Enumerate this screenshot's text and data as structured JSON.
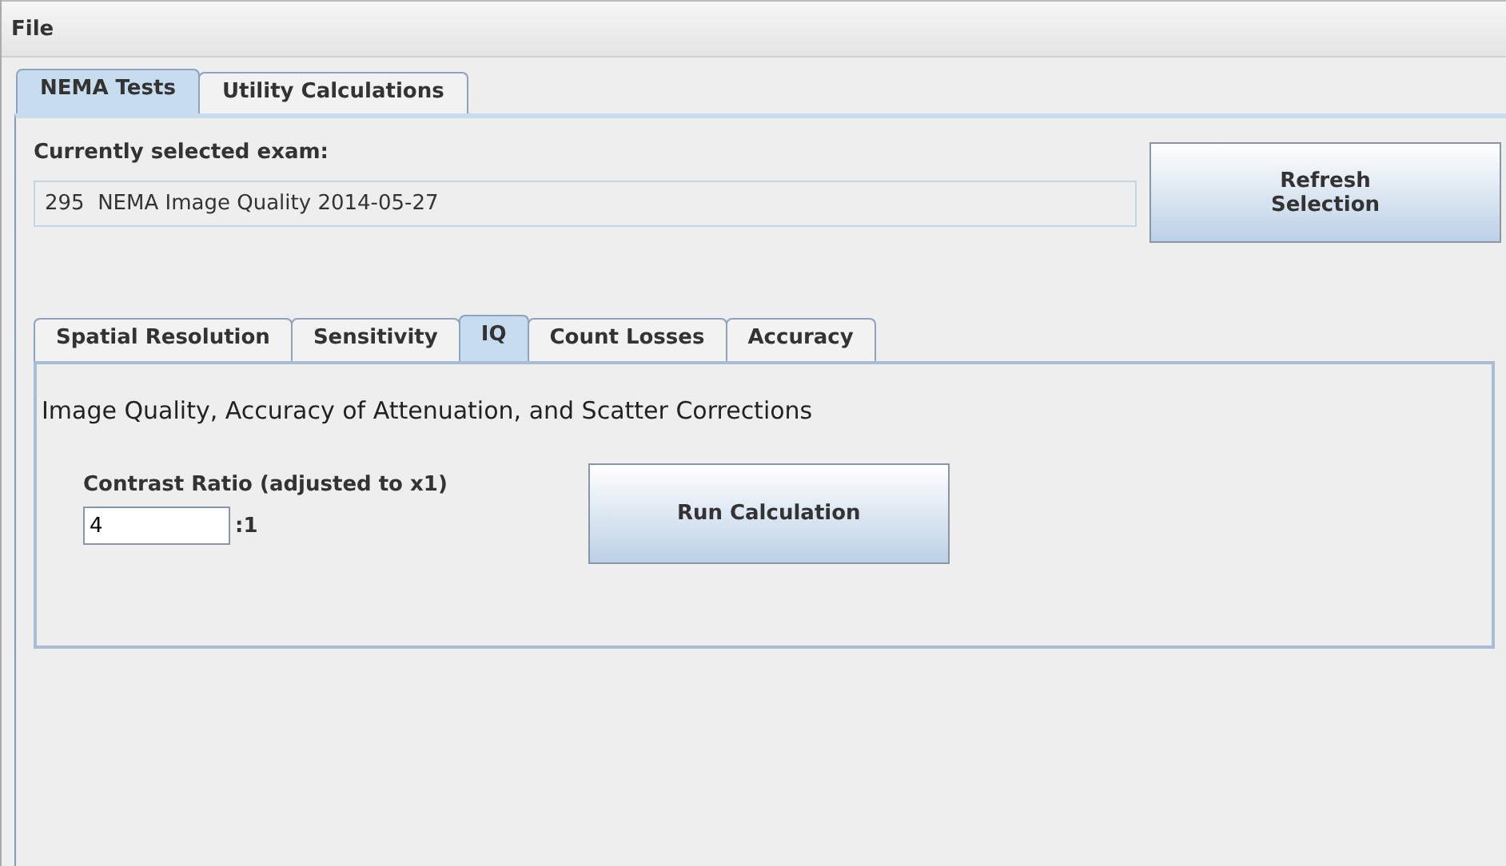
{
  "menu_bar": {
    "items": [
      "File"
    ]
  },
  "tabs": [
    {
      "label": "NEMA Tests",
      "selected": true
    },
    {
      "label": "Utility Calculations",
      "selected": false
    }
  ],
  "exam": {
    "label": "Currently selected exam:",
    "value": "295  NEMA Image Quality 2014-05-27"
  },
  "refresh_button": {
    "label": "Refresh\nSelection"
  },
  "sub_tabs": [
    {
      "label": "Spatial Resolution",
      "selected": false
    },
    {
      "label": "Sensitivity",
      "selected": false
    },
    {
      "label": "IQ",
      "selected": true
    },
    {
      "label": "Count Losses",
      "selected": false
    },
    {
      "label": "Accuracy",
      "selected": false
    }
  ],
  "panel": {
    "heading": "Image Quality, Accuracy of Attenuation, and Scatter Corrections",
    "contrast_label": "Contrast Ratio (adjusted to x1)",
    "contrast_value": "4",
    "suffix": ":1",
    "run_button": "Run Calculation"
  }
}
